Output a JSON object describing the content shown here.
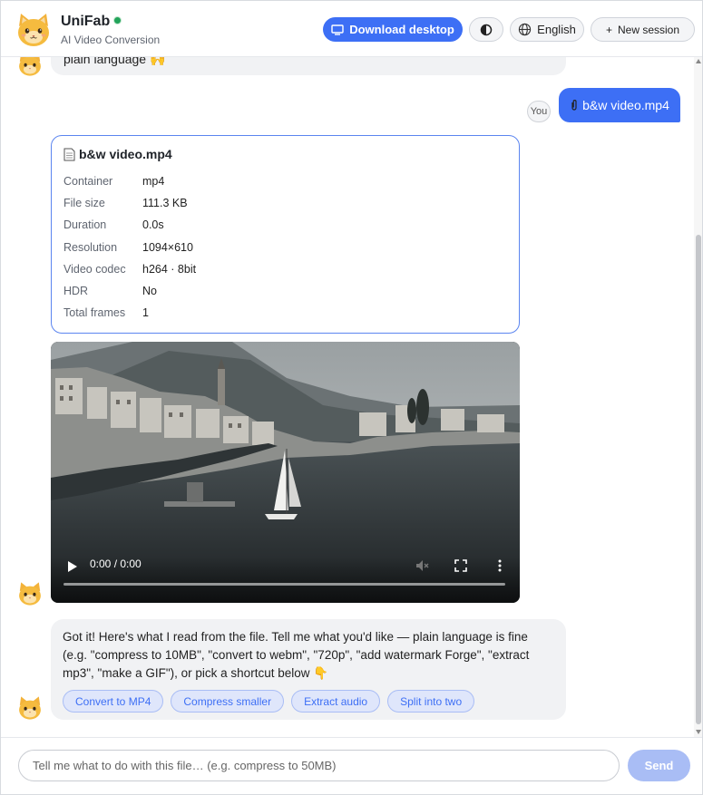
{
  "header": {
    "brand": "UniFab",
    "subtitle": "AI Video Conversion",
    "download_label": "Download desktop",
    "theme_icon": "contrast-icon",
    "language_label": "English",
    "new_session_label": "New session"
  },
  "chat": {
    "top_bubble_text": "plain language 🙌",
    "you_label": "You",
    "user_file_message": "b&w video.mp4",
    "info_card": {
      "title": "b&w video.mp4",
      "rows": [
        {
          "key": "Container",
          "value": "mp4"
        },
        {
          "key": "File size",
          "value": "111.3 KB"
        },
        {
          "key": "Duration",
          "value": "0.0s"
        },
        {
          "key": "Resolution",
          "value": "1094×610"
        },
        {
          "key": "Video codec",
          "value": "h264 · 8bit"
        },
        {
          "key": "HDR",
          "value": "No"
        },
        {
          "key": "Total frames",
          "value": "1"
        }
      ]
    },
    "video": {
      "time": "0:00 / 0:00",
      "progress": 0
    },
    "bot_message": "Got it! Here's what I read from the file. Tell me what you'd like — plain language is fine (e.g. \"compress to 10MB\", \"convert to webm\", \"720p\", \"add watermark Forge\", \"extract mp3\", \"make a GIF\"), or pick a shortcut below 👇",
    "shortcuts": [
      "Convert to MP4",
      "Compress smaller",
      "Extract audio",
      "Split into two"
    ]
  },
  "composer": {
    "placeholder": "Tell me what to do with this file… (e.g. compress to 50MB)",
    "value": "",
    "send_label": "Send"
  },
  "colors": {
    "accent": "#3d6ff5",
    "accent_light": "#a9bdf5",
    "online": "#22a35a"
  }
}
